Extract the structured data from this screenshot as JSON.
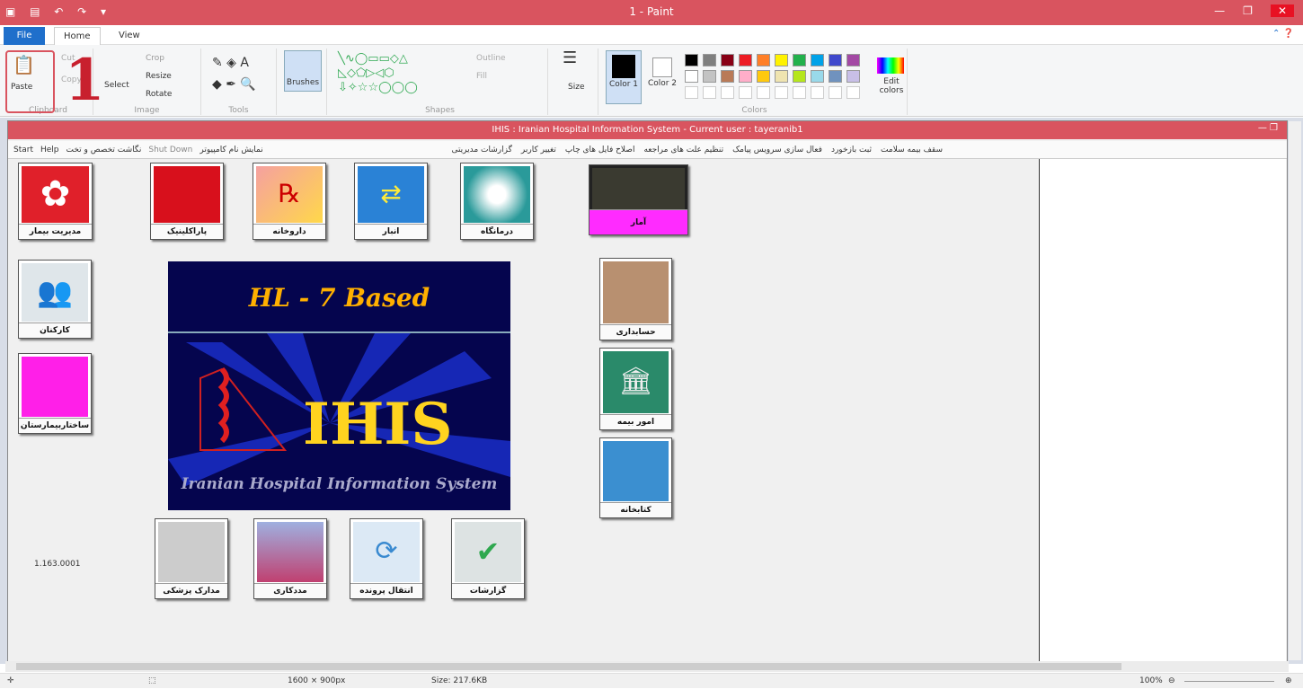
{
  "app": {
    "title": "1 - Paint"
  },
  "tabs": [
    {
      "label": "File"
    },
    {
      "label": "Home"
    },
    {
      "label": "View"
    }
  ],
  "ribbon": {
    "paste": "Paste",
    "cut": "Cut",
    "copy": "Copy",
    "clipboard": "Clipboard",
    "crop": "Crop",
    "resize": "Resize",
    "rotate": "Rotate",
    "select": "Select",
    "image": "Image",
    "tools": "Tools",
    "brushes": "Brushes",
    "shapes": "Shapes",
    "outline": "Outline",
    "fill": "Fill",
    "size": "Size",
    "color1": "Color 1",
    "color2": "Color 2",
    "colors": "Colors",
    "edit_colors": "Edit colors"
  },
  "annotation": {
    "step": "1"
  },
  "palette": [
    "#000000",
    "#7f7f7f",
    "#880015",
    "#ed1c24",
    "#ff7f27",
    "#fff200",
    "#22b14c",
    "#00a2e8",
    "#3f48cc",
    "#a349a4",
    "#ffffff",
    "#c3c3c3",
    "#b97a57",
    "#ffaec9",
    "#ffc90e",
    "#efe4b0",
    "#b5e61d",
    "#99d9ea",
    "#7092be",
    "#c8bfe7"
  ],
  "ihis": {
    "title": "IHIS : Iranian Hospital Information System - Current user : tayeranib1",
    "menu_left": [
      "Start",
      "Help",
      "نگاشت تخصص و تخت",
      "Shut Down",
      "نمایش نام کامپیوتر"
    ],
    "menu_right": [
      "سقف بیمه سلامت",
      "ثبت بازخورد",
      "فعال سازی سرویس پیامک",
      "تنظیم علت های مراجعه",
      "اصلاح فایل های چاپ",
      "تغییر کاربر",
      "گزارشات مدیریتی"
    ],
    "tiles": {
      "hospital_mgmt": "مدیریت بیمار",
      "paraclinic": "پاراکلینیک",
      "pharmacy": "داروخانه",
      "warehouse": "انبار",
      "clinic": "درمانگاه",
      "statistics": "آمار",
      "staff": "کارکنان",
      "structure": "ساختاربیمارستان",
      "accounting": "حسابداری",
      "insurance": "امور بیمه",
      "library": "کتابخانه",
      "medical_docs": "مدارک پزشکی",
      "social_work": "مددکاری",
      "file_transfer": "انتقال پرونده",
      "reports": "گزارشات"
    },
    "banner": {
      "hl7": "HL - 7 Based",
      "logo": "IHIS",
      "subtitle": "Iranian Hospital Information System"
    },
    "version": "1.163.0001"
  },
  "status": {
    "dimensions": "1600 × 900px",
    "size": "Size: 217.6KB",
    "zoom": "100%"
  }
}
